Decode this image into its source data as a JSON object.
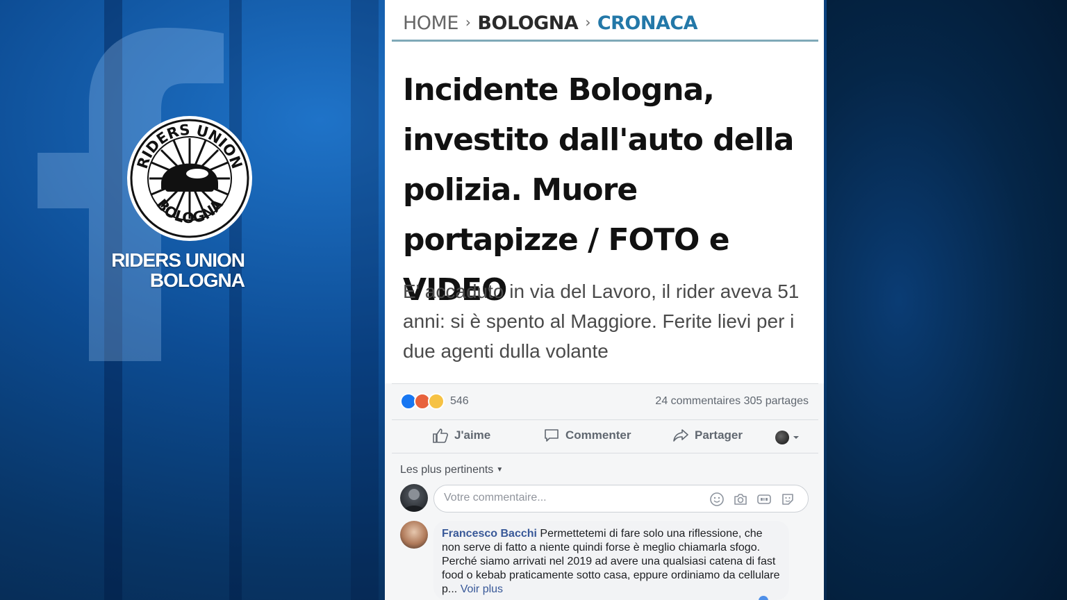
{
  "logo": {
    "emblem_text_top": "RIDERS UNION",
    "emblem_text_bottom": "BOLOGNA",
    "caption_line1": "RIDERS UNION",
    "caption_line2": "BOLOGNA"
  },
  "article": {
    "breadcrumb": [
      "HOME",
      "BOLOGNA",
      "CRONACA"
    ],
    "breadcrumb_separator": "›",
    "headline": "Incidente Bologna, investito dall'auto della polizia. Muore portapizze / FOTO e VIDEO",
    "subtitle": "E' accaduto in via del Lavoro, il rider aveva 51 anni: si è spento al Maggiore. Ferite lievi per i due agenti dulla volante"
  },
  "post": {
    "reaction_count": "546",
    "comments_count": "24 commentaires",
    "shares_count": "305 partages",
    "actions": {
      "like": "J'aime",
      "comment": "Commenter",
      "share": "Partager"
    },
    "sort_label": "Les plus pertinents",
    "comment_placeholder": "Votre commentaire...",
    "colors": {
      "like": "#1877f2",
      "angry": "#e8623c",
      "sad": "#f6c244",
      "link": "#385898"
    }
  },
  "comments": [
    {
      "author": "Francesco Bacchi",
      "text": "Permettetemi di fare solo una riflessione, che non serve di fatto a niente quindi forse è meglio chiamarla sfogo. Perché siamo arrivati nel 2019 ad avere una qualsiasi catena di fast food o kebab praticamente sotto casa, eppure ordiniamo da cellulare p...",
      "more_label": "Voir plus"
    }
  ],
  "icons": [
    "facebook-f-icon",
    "thumbs-up-icon",
    "comment-icon",
    "share-icon",
    "chevron-down-icon",
    "emoji-icon",
    "camera-icon",
    "gif-icon",
    "sticker-icon"
  ]
}
